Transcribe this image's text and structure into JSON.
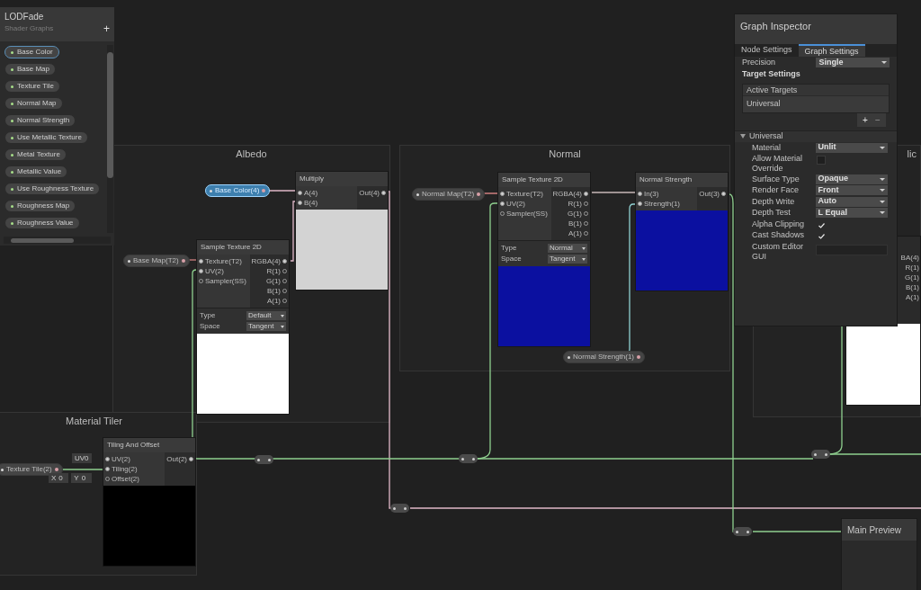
{
  "blackboard": {
    "title": "LODFade",
    "subtitle": "Shader Graphs",
    "add_label": "+",
    "properties": [
      {
        "name": "Base Color",
        "selected": true
      },
      {
        "name": "Base Map",
        "selected": false
      },
      {
        "name": "Texture Tile",
        "selected": false
      },
      {
        "name": "Normal Map",
        "selected": false
      },
      {
        "name": "Normal Strength",
        "selected": false
      },
      {
        "name": "Use Metallic Texture",
        "selected": false
      },
      {
        "name": "Metal Texture",
        "selected": false
      },
      {
        "name": "Metallic Value",
        "selected": false
      },
      {
        "name": "Use Roughness Texture",
        "selected": false
      },
      {
        "name": "Roughness Map",
        "selected": false
      },
      {
        "name": "Roughness Value",
        "selected": false
      }
    ]
  },
  "groups": [
    {
      "title": "Albedo"
    },
    {
      "title": "Normal"
    },
    {
      "title": "Material Tiler"
    },
    {
      "title": "lic"
    }
  ],
  "property_nodes": [
    {
      "label": "Base Color(4)",
      "selected": true
    },
    {
      "label": "Base Map(T2)",
      "selected": false
    },
    {
      "label": "Normal Map(T2)",
      "selected": false
    },
    {
      "label": "Normal Strength(1)",
      "selected": false
    },
    {
      "label": "Texture Tile(2)",
      "selected": false
    }
  ],
  "nodes": [
    {
      "title": "Multiply",
      "inputs": [
        "A(4)",
        "B(4)"
      ],
      "outputs": [
        "Out(4)"
      ],
      "color": "#d3d3d3"
    },
    {
      "title": "Sample Texture 2D",
      "inputs": [
        "Texture(T2)",
        "UV(2)",
        "Sampler(SS)"
      ],
      "outputs": [
        "RGBA(4)",
        "R(1)",
        "G(1)",
        "B(1)",
        "A(1)"
      ],
      "settings": [
        {
          "label": "Type",
          "value": "Default"
        },
        {
          "label": "Space",
          "value": "Tangent"
        }
      ],
      "color": "#ffffff"
    },
    {
      "title": "Sample Texture 2D",
      "inputs": [
        "Texture(T2)",
        "UV(2)",
        "Sampler(SS)"
      ],
      "outputs": [
        "RGBA(4)",
        "R(1)",
        "G(1)",
        "B(1)",
        "A(1)"
      ],
      "settings": [
        {
          "label": "Type",
          "value": "Normal"
        },
        {
          "label": "Space",
          "value": "Tangent"
        }
      ],
      "color": "#0b10a0"
    },
    {
      "title": "Normal Strength",
      "inputs": [
        "In(3)",
        "Strength(1)"
      ],
      "outputs": [
        "Out(3)"
      ],
      "color": "#0b10a0"
    },
    {
      "title": "Tiling And Offset",
      "inputs": [
        "UV(2)",
        "Tiling(2)",
        "Offset(2)"
      ],
      "outputs": [
        "Out(2)"
      ],
      "color": "#000000"
    }
  ],
  "tiling_inputs": {
    "uv_channel": "UV0",
    "offset": [
      {
        "axis": "X",
        "value": "0"
      },
      {
        "axis": "Y",
        "value": "0"
      }
    ]
  },
  "partial_node": {
    "outputs": [
      "BA(4)",
      "R(1)",
      "G(1)",
      "B(1)",
      "A(1)"
    ],
    "color": "#ffffff"
  },
  "inspector": {
    "title": "Graph Inspector",
    "tabs": [
      {
        "label": "Node Settings",
        "selected": false
      },
      {
        "label": "Graph Settings",
        "selected": true
      }
    ],
    "precision": {
      "label": "Precision",
      "value": "Single"
    },
    "target_settings": {
      "heading": "Target Settings",
      "list_header": "Active Targets",
      "items": [
        "Universal"
      ],
      "add_label": "+",
      "remove_label": "−"
    },
    "section": {
      "title": "Universal",
      "expanded": true,
      "rows": [
        {
          "kind": "dropdown",
          "label": "Material",
          "value": "Unlit"
        },
        {
          "kind": "checkbox",
          "label": "Allow Material Override",
          "checked": false
        },
        {
          "kind": "dropdown",
          "label": "Surface Type",
          "value": "Opaque"
        },
        {
          "kind": "dropdown",
          "label": "Render Face",
          "value": "Front"
        },
        {
          "kind": "dropdown",
          "label": "Depth Write",
          "value": "Auto"
        },
        {
          "kind": "dropdown",
          "label": "Depth Test",
          "value": "L Equal"
        },
        {
          "kind": "checkbox",
          "label": "Alpha Clipping",
          "checked": true
        },
        {
          "kind": "checkbox",
          "label": "Cast Shadows",
          "checked": true
        },
        {
          "kind": "text",
          "label": "Custom Editor GUI"
        }
      ]
    }
  },
  "main_preview": {
    "title": "Main Preview"
  }
}
